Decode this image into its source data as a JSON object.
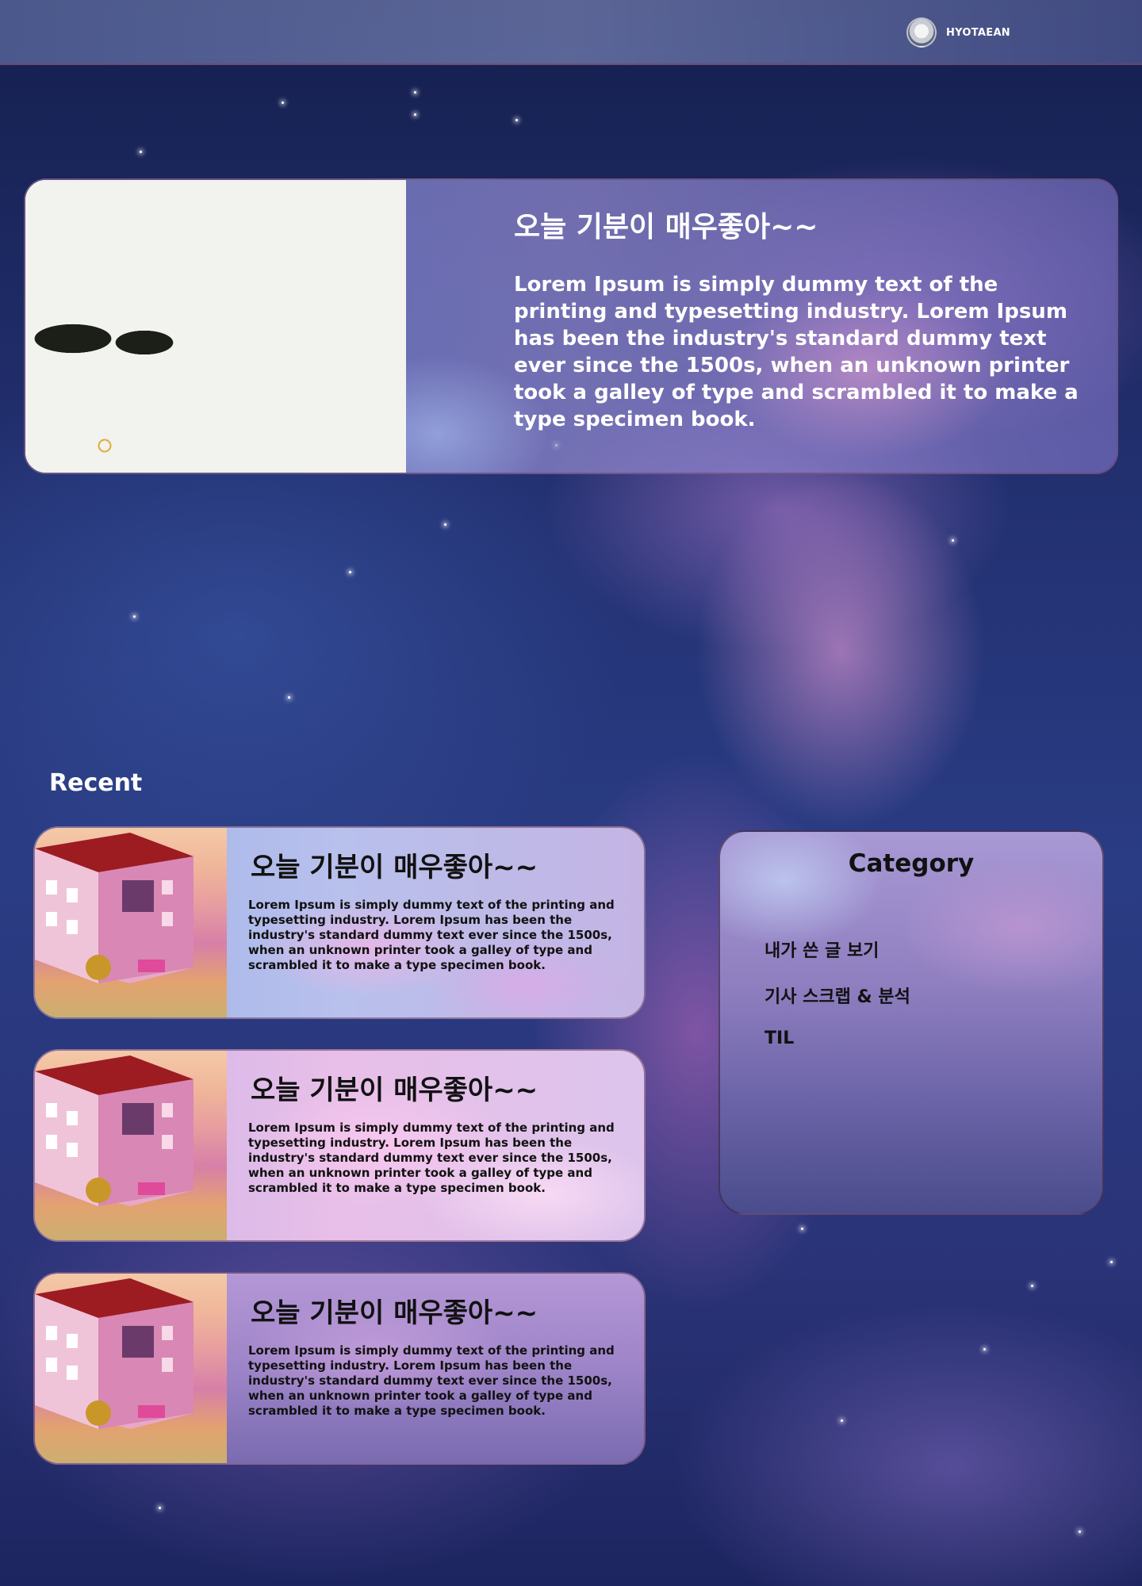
{
  "header": {
    "username": "HYOTAEAN"
  },
  "featured": {
    "title": "오늘 기분이 매우좋아~~",
    "text": "Lorem Ipsum is simply dummy text of the printing and typesetting industry. Lorem Ipsum has been the industry's standard dummy text ever since the 1500s, when an unknown printer took a galley of type and scrambled it to make a type specimen book."
  },
  "recent": {
    "heading": "Recent",
    "posts": [
      {
        "title": "오늘 기분이 매우좋아~~",
        "text": "Lorem Ipsum is simply dummy text of the printing and typesetting industry. Lorem Ipsum has been the industry's standard dummy text ever since the 1500s, when an unknown printer took a galley of type and scrambled it to make a type specimen book."
      },
      {
        "title": "오늘 기분이 매우좋아~~",
        "text": "Lorem Ipsum is simply dummy text of the printing and typesetting industry. Lorem Ipsum has been the industry's standard dummy text ever since the 1500s, when an unknown printer took a galley of type and scrambled it to make a type specimen book."
      },
      {
        "title": "오늘 기분이 매우좋아~~",
        "text": "Lorem Ipsum is simply dummy text of the printing and typesetting industry. Lorem Ipsum has been the industry's standard dummy text ever since the 1500s, when an unknown printer took a galley of type and scrambled it to make a type specimen book."
      }
    ]
  },
  "category": {
    "title": "Category",
    "items": [
      "내가 쓴 글 보기",
      "기사 스크랩 & 분석",
      "TIL"
    ]
  }
}
